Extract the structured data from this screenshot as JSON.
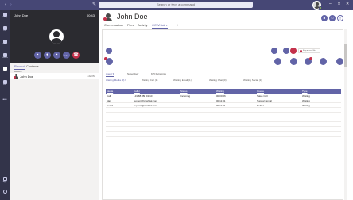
{
  "titlebar": {
    "search_placeholder": "Search or type a command",
    "minimize": "–",
    "maximize": "□",
    "close": "✕",
    "back": "‹",
    "forward": "›"
  },
  "rail": {
    "items": [
      {
        "label": "Activity"
      },
      {
        "label": "Chat"
      },
      {
        "label": "Teams"
      },
      {
        "label": "Calendar"
      },
      {
        "label": "Calls"
      },
      {
        "label": "Files"
      }
    ],
    "more": "•••",
    "bottom": [
      {
        "label": "Apps"
      },
      {
        "label": "Help"
      }
    ]
  },
  "call": {
    "caller_name": "John Doe",
    "timer": "00:43"
  },
  "left": {
    "tabs": [
      "Recent",
      "Contacts"
    ],
    "recent_header": "Recent",
    "recent_items": [
      {
        "name": "John Doe",
        "time": "1:22 PM"
      }
    ]
  },
  "contact": {
    "name": "John Doe",
    "tabs": [
      "Conversation",
      "Files",
      "Activity",
      "CCWhisk ▾",
      "+"
    ]
  },
  "panel": {
    "status": "Busy ▾ Lunch Brk",
    "agent_tabs": [
      "Agent ▾",
      "Supervisor",
      "KPI Dynamics"
    ],
    "queue_tabs": [
      "Waiting Media (3) ▾",
      "Waiting Call (1)",
      "Waiting Email (1)",
      "Waiting Chat (0)",
      "Waiting Social (1)"
    ],
    "columns": [
      "Media",
      "Caller",
      "Status",
      "Waiting",
      "Queue",
      "Type"
    ],
    "rows": [
      [
        "Call",
        "+31 88 888 01 10",
        "Incoming",
        "00:00:06",
        "Sales Call",
        "Waiting"
      ],
      [
        "Mail",
        "support@ccwhisk.com",
        "",
        "00:11:31",
        "Support Email",
        "Waiting"
      ],
      [
        "Social",
        "support@ccwhisk.com",
        "",
        "00:11:21",
        "Twitter",
        "Waiting"
      ]
    ]
  },
  "colors": {
    "brand": "#6264a7",
    "titlebar": "#464775",
    "rail": "#33344a",
    "danger": "#c4314b",
    "presence": "#92c353"
  }
}
